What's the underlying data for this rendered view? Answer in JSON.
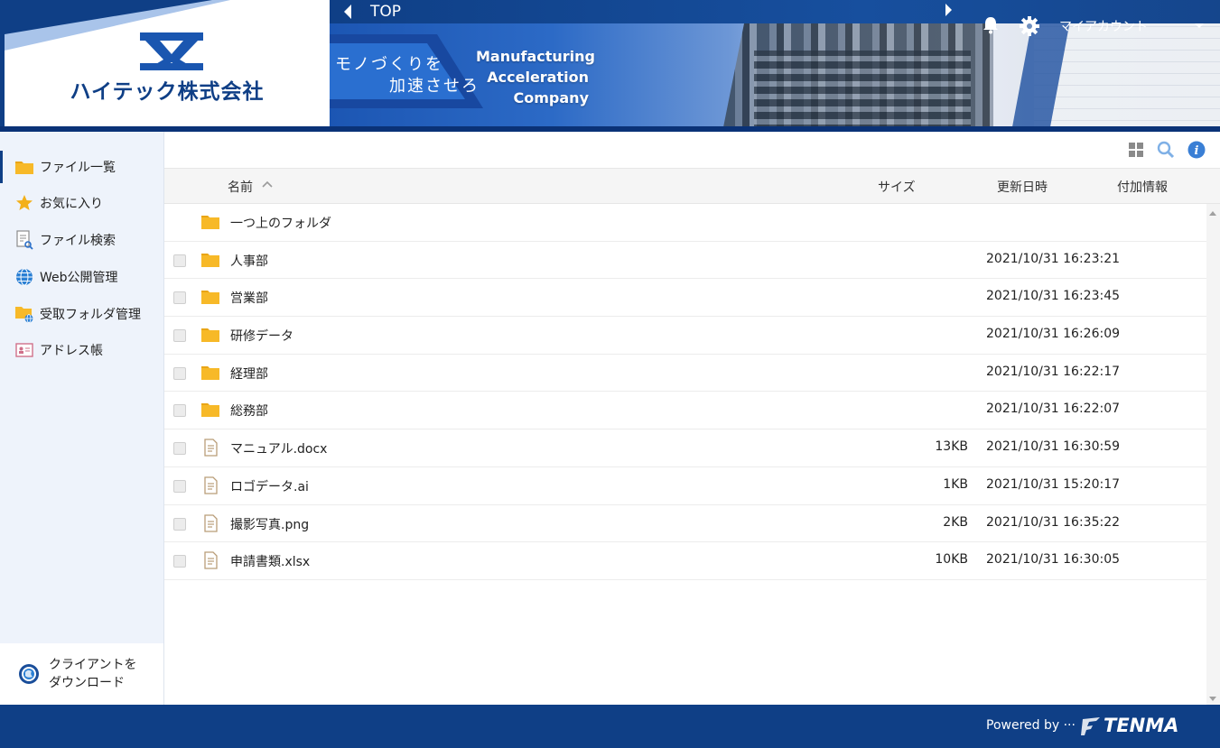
{
  "header": {
    "logo_text": "ハイテック株式会社",
    "slogan_jp_1": "モノづくりを",
    "slogan_jp_2": "加速させろ",
    "slogan_en_1": "Manufacturing",
    "slogan_en_2": "Acceleration",
    "slogan_en_3": "Company",
    "breadcrumb": "TOP",
    "account_label": "マイアカウント"
  },
  "sidebar": {
    "items": [
      {
        "label": "ファイル一覧",
        "icon": "folder-icon"
      },
      {
        "label": "お気に入り",
        "icon": "star-icon"
      },
      {
        "label": "ファイル検索",
        "icon": "file-search-icon"
      },
      {
        "label": "Web公開管理",
        "icon": "globe-icon"
      },
      {
        "label": "受取フォルダ管理",
        "icon": "receive-folder-icon"
      },
      {
        "label": "アドレス帳",
        "icon": "address-book-icon"
      }
    ],
    "client_download": "クライアントを\nダウンロード"
  },
  "table": {
    "columns": {
      "name": "名前",
      "size": "サイズ",
      "modified": "更新日時",
      "info": "付加情報"
    },
    "parent_folder": "一つ上のフォルダ",
    "rows": [
      {
        "type": "folder",
        "name": "人事部",
        "size": "",
        "modified": "2021/10/31 16:23:21"
      },
      {
        "type": "folder",
        "name": "営業部",
        "size": "",
        "modified": "2021/10/31 16:23:45"
      },
      {
        "type": "folder",
        "name": "研修データ",
        "size": "",
        "modified": "2021/10/31 16:26:09"
      },
      {
        "type": "folder",
        "name": "経理部",
        "size": "",
        "modified": "2021/10/31 16:22:17"
      },
      {
        "type": "folder",
        "name": "総務部",
        "size": "",
        "modified": "2021/10/31 16:22:07"
      },
      {
        "type": "file",
        "name": "マニュアル.docx",
        "size": "13KB",
        "modified": "2021/10/31 16:30:59"
      },
      {
        "type": "file",
        "name": "ロゴデータ.ai",
        "size": "1KB",
        "modified": "2021/10/31 15:20:17"
      },
      {
        "type": "file",
        "name": "撮影写真.png",
        "size": "2KB",
        "modified": "2021/10/31 16:35:22"
      },
      {
        "type": "file",
        "name": "申請書類.xlsx",
        "size": "10KB",
        "modified": "2021/10/31 16:30:05"
      }
    ]
  },
  "footer": {
    "powered_by": "Powered by ···",
    "brand": "TENMA"
  },
  "colors": {
    "brand_navy": "#0f3f86",
    "folder_yellow": "#f7b928",
    "sidebar_bg": "#eef3fb"
  }
}
